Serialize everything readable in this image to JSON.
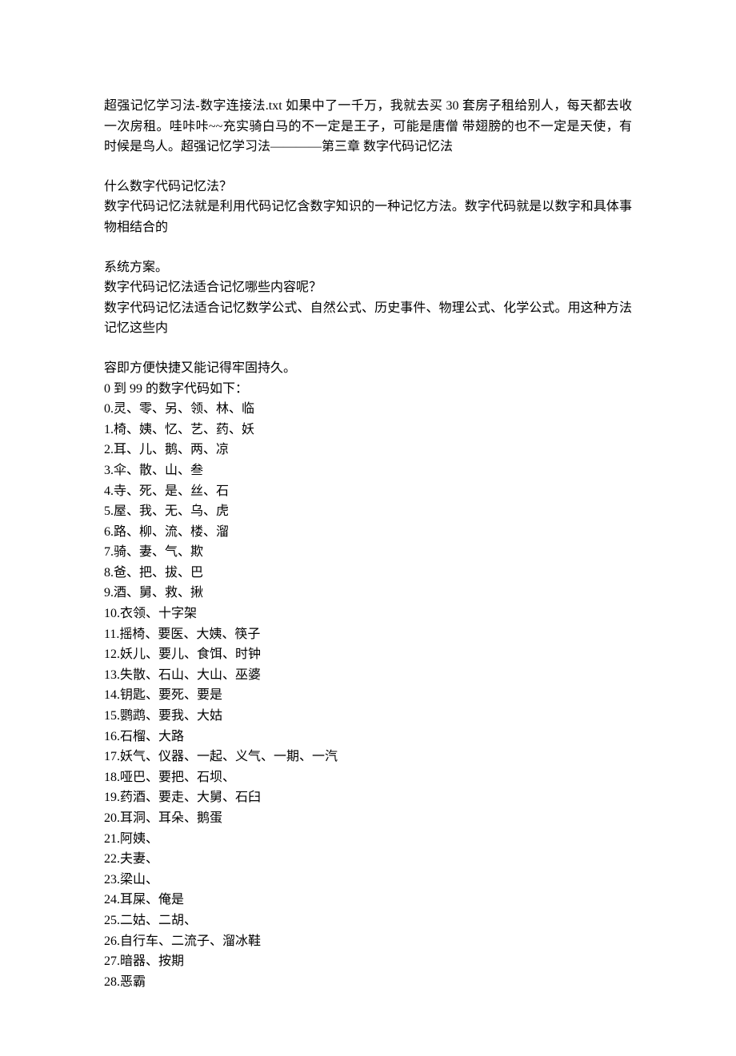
{
  "intro": "超强记忆学习法-数字连接法.txt 如果中了一千万，我就去买 30 套房子租给别人，每天都去收一次房租。哇咔咔~~充实骑白马的不一定是王子，可能是唐僧 带翅膀的也不一定是天使，有时候是鸟人。超强记忆学习法————第三章 数字代码记忆法",
  "block2": {
    "line1": "什么数字代码记忆法？",
    "line2": "数字代码记忆法就是利用代码记忆含数字知识的一种记忆方法。数字代码就是以数字和具体事物相结合的"
  },
  "block3": {
    "line1": "系统方案。",
    "line2": "数字代码记忆法适合记忆哪些内容呢？",
    "line3": "数字代码记忆法适合记忆数学公式、自然公式、历史事件、物理公式、化学公式。用这种方法记忆这些内"
  },
  "block4": {
    "line1": "容即方便快捷又能记得牢固持久。",
    "line2": "0 到 99 的数字代码如下："
  },
  "codes": [
    "0.灵、零、另、领、林、临",
    "1.椅、姨、忆、艺、药、妖",
    "2.耳、儿、鹅、两、凉",
    "3.伞、散、山、叁",
    "4.寺、死、是、丝、石",
    "5.屋、我、无、乌、虎",
    "6.路、柳、流、楼、溜",
    "7.骑、妻、气、欺",
    "8.爸、把、拔、巴",
    "9.酒、舅、救、揪",
    "10.衣领、十字架",
    "11.摇椅、要医、大姨、筷子",
    "12.妖儿、要儿、食饵、时钟",
    "13.失散、石山、大山、巫婆",
    "14.钥匙、要死、要是",
    "15.鹦鹉、要我、大姑",
    "16.石榴、大路",
    "17.妖气、仪器、一起、义气、一期、一汽",
    "18.哑巴、要把、石坝、",
    "19.药酒、要走、大舅、石臼",
    "20.耳洞、耳朵、鹅蛋",
    "21.阿姨、",
    "22.夫妻、",
    "23.梁山、",
    "24.耳屎、俺是",
    "25.二姑、二胡、",
    "26.自行车、二流子、溜冰鞋",
    "27.暗器、按期",
    "28.恶霸"
  ]
}
